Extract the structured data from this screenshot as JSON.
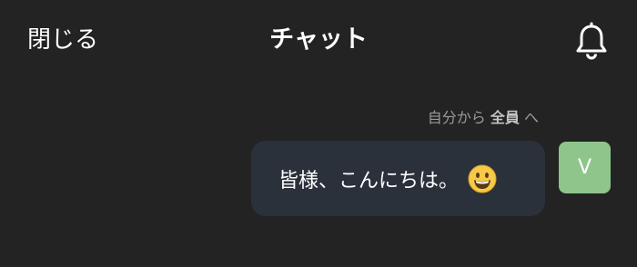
{
  "header": {
    "close_label": "閉じる",
    "title": "チャット",
    "bell_icon": "bell-icon"
  },
  "message": {
    "from_prefix": "自分から",
    "recipient": "全員",
    "to_suffix": "へ",
    "text": "皆様、こんにちは。",
    "emoji_icon": "grinning-face-emoji",
    "avatar_initial": "V",
    "avatar_color": "#8ec58b",
    "bubble_color": "#2b313b"
  },
  "colors": {
    "background": "#232323",
    "text": "#ffffff",
    "muted": "#9a9a9a"
  }
}
